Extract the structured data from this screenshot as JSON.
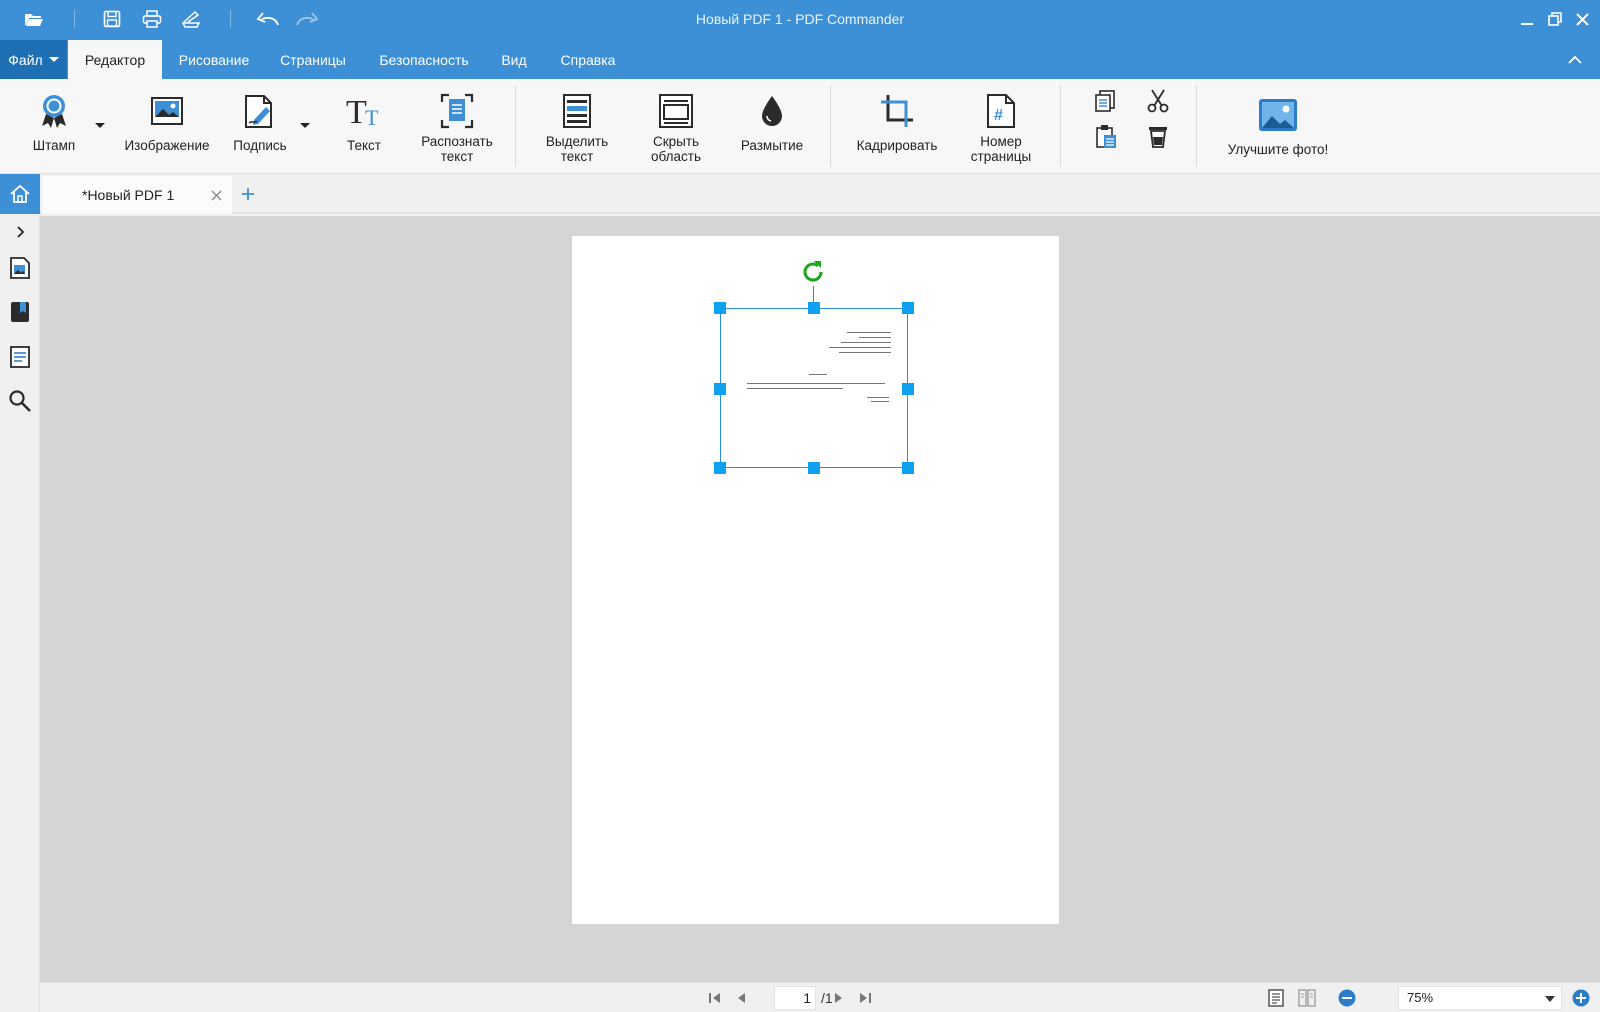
{
  "window": {
    "title": "Новый PDF 1 - PDF Commander"
  },
  "menu": {
    "file_label": "Файл",
    "tabs": [
      {
        "label": "Редактор",
        "active": true
      },
      {
        "label": "Рисование"
      },
      {
        "label": "Страницы"
      },
      {
        "label": "Безопасность"
      },
      {
        "label": "Вид"
      },
      {
        "label": "Справка"
      }
    ]
  },
  "ribbon": {
    "items": [
      {
        "label": "Штамп"
      },
      {
        "label": "Изображение"
      },
      {
        "label": "Подпись"
      },
      {
        "label": "Текст"
      },
      {
        "label": "Распознать\nтекст"
      },
      {
        "label": "Выделить\nтекст"
      },
      {
        "label": "Скрыть\nобласть"
      },
      {
        "label": "Размытие"
      },
      {
        "label": "Кадрировать"
      },
      {
        "label": "Номер\nстраницы"
      },
      {
        "label": "Улучшите фото!"
      }
    ]
  },
  "tabs": {
    "doc_title": "*Новый PDF 1"
  },
  "statusbar": {
    "page_current": "1",
    "page_total": "/1",
    "zoom": "75%"
  },
  "colors": {
    "accent": "#3d8fd6",
    "file_button": "#1f6fb5",
    "handle": "#10a0f0",
    "rotate": "#1aa51a",
    "canvas": "#d5d5d5"
  }
}
